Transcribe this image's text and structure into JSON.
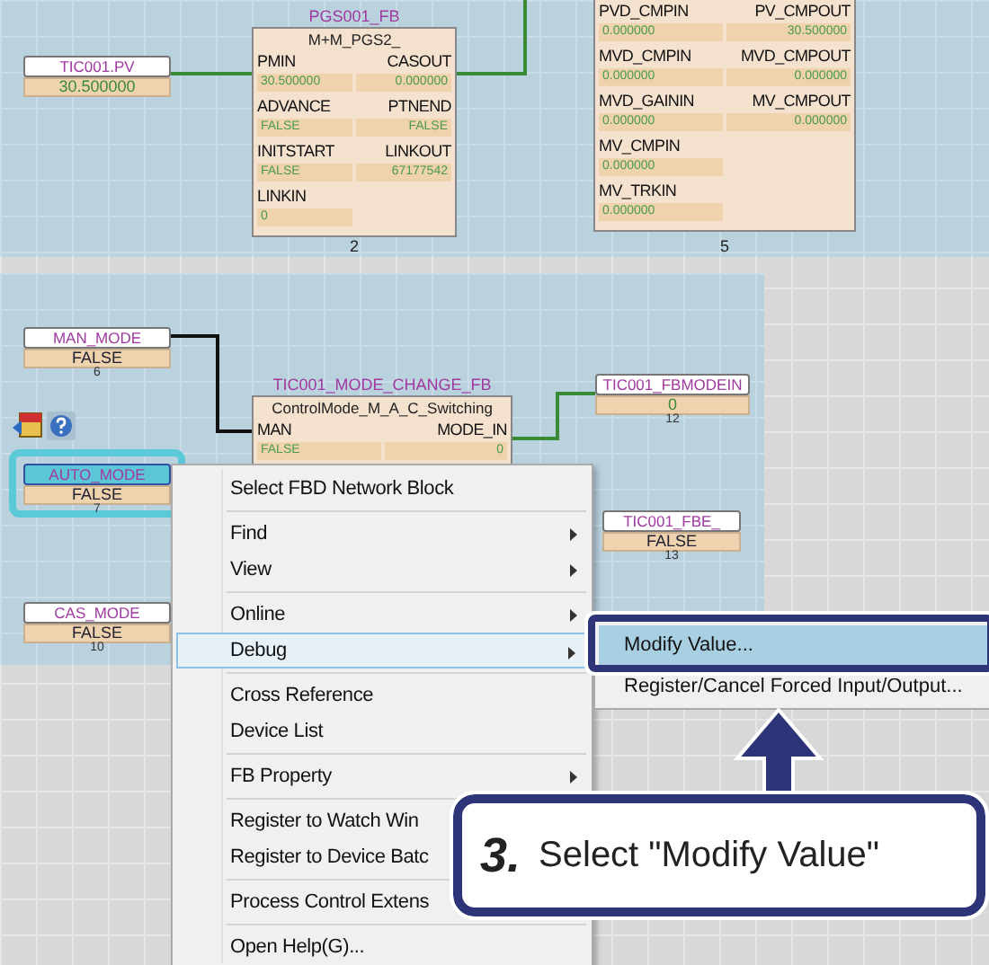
{
  "variables": [
    {
      "name": "TIC001.PV",
      "value": "30.500000",
      "kind": "number",
      "selected": false
    },
    {
      "name": "MAN_MODE",
      "value": "FALSE",
      "kind": "bool",
      "number": "6",
      "selected": false
    },
    {
      "name": "AUTO_MODE",
      "value": "FALSE",
      "kind": "bool",
      "number": "7",
      "selected": true
    },
    {
      "name": "CAS_MODE",
      "value": "FALSE",
      "kind": "bool",
      "number": "10",
      "selected": false
    },
    {
      "name": "TIC001_FBMODEIN",
      "value": "0",
      "kind": "number",
      "number": "12",
      "selected": false
    },
    {
      "name": "TIC001_FBE_",
      "value": "FALSE",
      "kind": "bool",
      "number": "13",
      "selected": false
    }
  ],
  "blocks": [
    {
      "instance": "PGS001_FB",
      "type": "M+M_PGS2_",
      "number": "2",
      "rows": [
        {
          "in": "PMIN",
          "in_value": "30.500000",
          "out": "CASOUT",
          "out_value": "0.000000"
        },
        {
          "in": "ADVANCE",
          "in_value": "FALSE",
          "out": "PTNEND",
          "out_value": "FALSE"
        },
        {
          "in": "INITSTART",
          "in_value": "FALSE",
          "out": "LINKOUT",
          "out_value": "67177542"
        },
        {
          "in": "LINKIN",
          "in_value": "0",
          "out": "",
          "out_value": ""
        }
      ]
    },
    {
      "number": "5",
      "rows": [
        {
          "in": "PVD_CMPIN",
          "in_value": "0.000000",
          "out": "PV_CMPOUT",
          "out_value": "30.500000"
        },
        {
          "in": "MVD_CMPIN",
          "in_value": "0.000000",
          "out": "MVD_CMPOUT",
          "out_value": "0.000000"
        },
        {
          "in": "MVD_GAININ",
          "in_value": "0.000000",
          "out": "MV_CMPOUT",
          "out_value": "0.000000"
        },
        {
          "in": "MV_CMPIN",
          "in_value": "0.000000",
          "out": "",
          "out_value": ""
        },
        {
          "in": "MV_TRKIN",
          "in_value": "0.000000",
          "out": "",
          "out_value": ""
        }
      ]
    },
    {
      "instance": "TIC001_MODE_CHANGE_FB",
      "type": "ControlMode_M_A_C_Switching",
      "rows": [
        {
          "in": "MAN",
          "in_value": "FALSE",
          "out": "MODE_IN",
          "out_value": "0"
        }
      ]
    }
  ],
  "context_menu": [
    [
      {
        "label": "Select FBD Network Block",
        "submenu": false,
        "selected": false
      }
    ],
    [
      {
        "label": "Find",
        "submenu": true,
        "selected": false
      },
      {
        "label": "View",
        "submenu": true,
        "selected": false
      }
    ],
    [
      {
        "label": "Online",
        "submenu": true,
        "selected": false
      },
      {
        "label": "Debug",
        "submenu": true,
        "selected": true
      }
    ],
    [
      {
        "label": "Cross Reference",
        "submenu": false,
        "selected": false
      },
      {
        "label": "Device List",
        "submenu": false,
        "selected": false
      }
    ],
    [
      {
        "label": "FB Property",
        "submenu": true,
        "selected": false
      }
    ],
    [
      {
        "label": "Register to Watch Win",
        "submenu": false,
        "selected": false
      },
      {
        "label": "Register to Device Batc",
        "submenu": false,
        "selected": false
      }
    ],
    [
      {
        "label": "Process Control Extens",
        "submenu": false,
        "selected": false
      }
    ],
    [
      {
        "label": "Open Help(G)...",
        "submenu": false,
        "selected": false
      }
    ]
  ],
  "submenu": [
    {
      "label": "Modify Value...",
      "selected": true
    },
    {
      "label": "Register/Cancel Forced Input/Output...",
      "selected": false
    }
  ],
  "callout": {
    "step": "3.",
    "text": "Select \"Modify Value\""
  }
}
